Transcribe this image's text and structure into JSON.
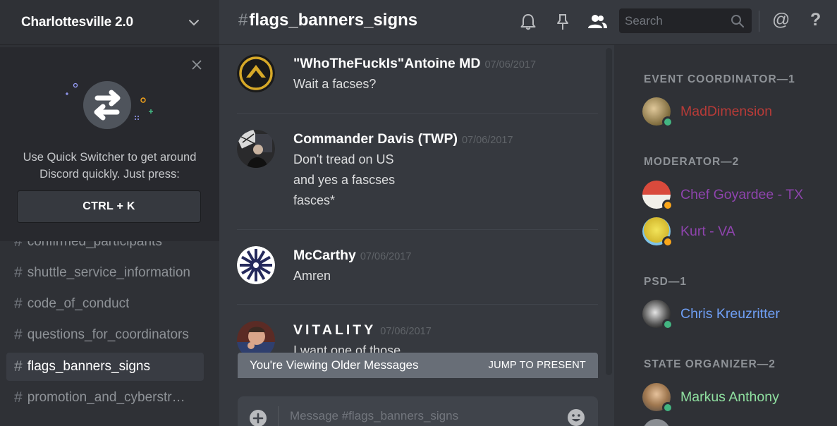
{
  "server": {
    "name": "Charlottesville 2.0"
  },
  "quick_switcher": {
    "text_line1": "Use Quick Switcher to get around",
    "text_line2": "Discord quickly. Just press:",
    "shortcut": "CTRL + K"
  },
  "channels": [
    {
      "name": "confirmed_participants",
      "active": false
    },
    {
      "name": "shuttle_service_information",
      "active": false
    },
    {
      "name": "code_of_conduct",
      "active": false
    },
    {
      "name": "questions_for_coordinators",
      "active": false
    },
    {
      "name": "flags_banners_signs",
      "active": true
    },
    {
      "name": "promotion_and_cyberstreaming",
      "active": false
    }
  ],
  "channel_hash": "#",
  "header": {
    "hash": "#",
    "title": "flags_banners_signs",
    "search_placeholder": "Search",
    "mention_icon_label": "@",
    "help_icon_label": "?"
  },
  "messages": [
    {
      "author": "\"WhoTheFuckIs\"Antoine MD",
      "timestamp": "07/06/2017",
      "lines": [
        "Wait a facses?"
      ]
    },
    {
      "author": "Commander Davis (TWP)",
      "timestamp": "07/06/2017",
      "lines": [
        "Don't tread on US",
        "and yes a fascses",
        "fasces*"
      ]
    },
    {
      "author": "McCarthy",
      "timestamp": "07/06/2017",
      "lines": [
        "Amren"
      ]
    },
    {
      "author": "VITALITY",
      "timestamp": "07/06/2017",
      "lines": [
        "I want one of those"
      ]
    }
  ],
  "older_bar": {
    "text": "You're Viewing Older Messages",
    "jump": "JUMP TO PRESENT"
  },
  "composer": {
    "placeholder": "Message #flags_banners_signs"
  },
  "members": {
    "groups": [
      {
        "heading": "EVENT COORDINATOR—1",
        "members": [
          {
            "name": "MadDimension",
            "color": "#b83b38",
            "status": "online"
          }
        ]
      },
      {
        "heading": "MODERATOR—2",
        "members": [
          {
            "name": "Chef Goyardee - TX",
            "color": "#8e44ad",
            "status": "idle"
          },
          {
            "name": "Kurt - VA",
            "color": "#8e44ad",
            "status": "idle"
          }
        ]
      },
      {
        "heading": "PSD—1",
        "members": [
          {
            "name": "Chris Kreuzritter",
            "color": "#6f9ff5",
            "status": "online"
          }
        ]
      },
      {
        "heading": "STATE ORGANIZER—2",
        "members": [
          {
            "name": "Markus Anthony",
            "color": "#8fe0a0",
            "status": "online"
          }
        ]
      }
    ]
  },
  "colors": {
    "online": "#43b581",
    "idle": "#faa61a"
  }
}
